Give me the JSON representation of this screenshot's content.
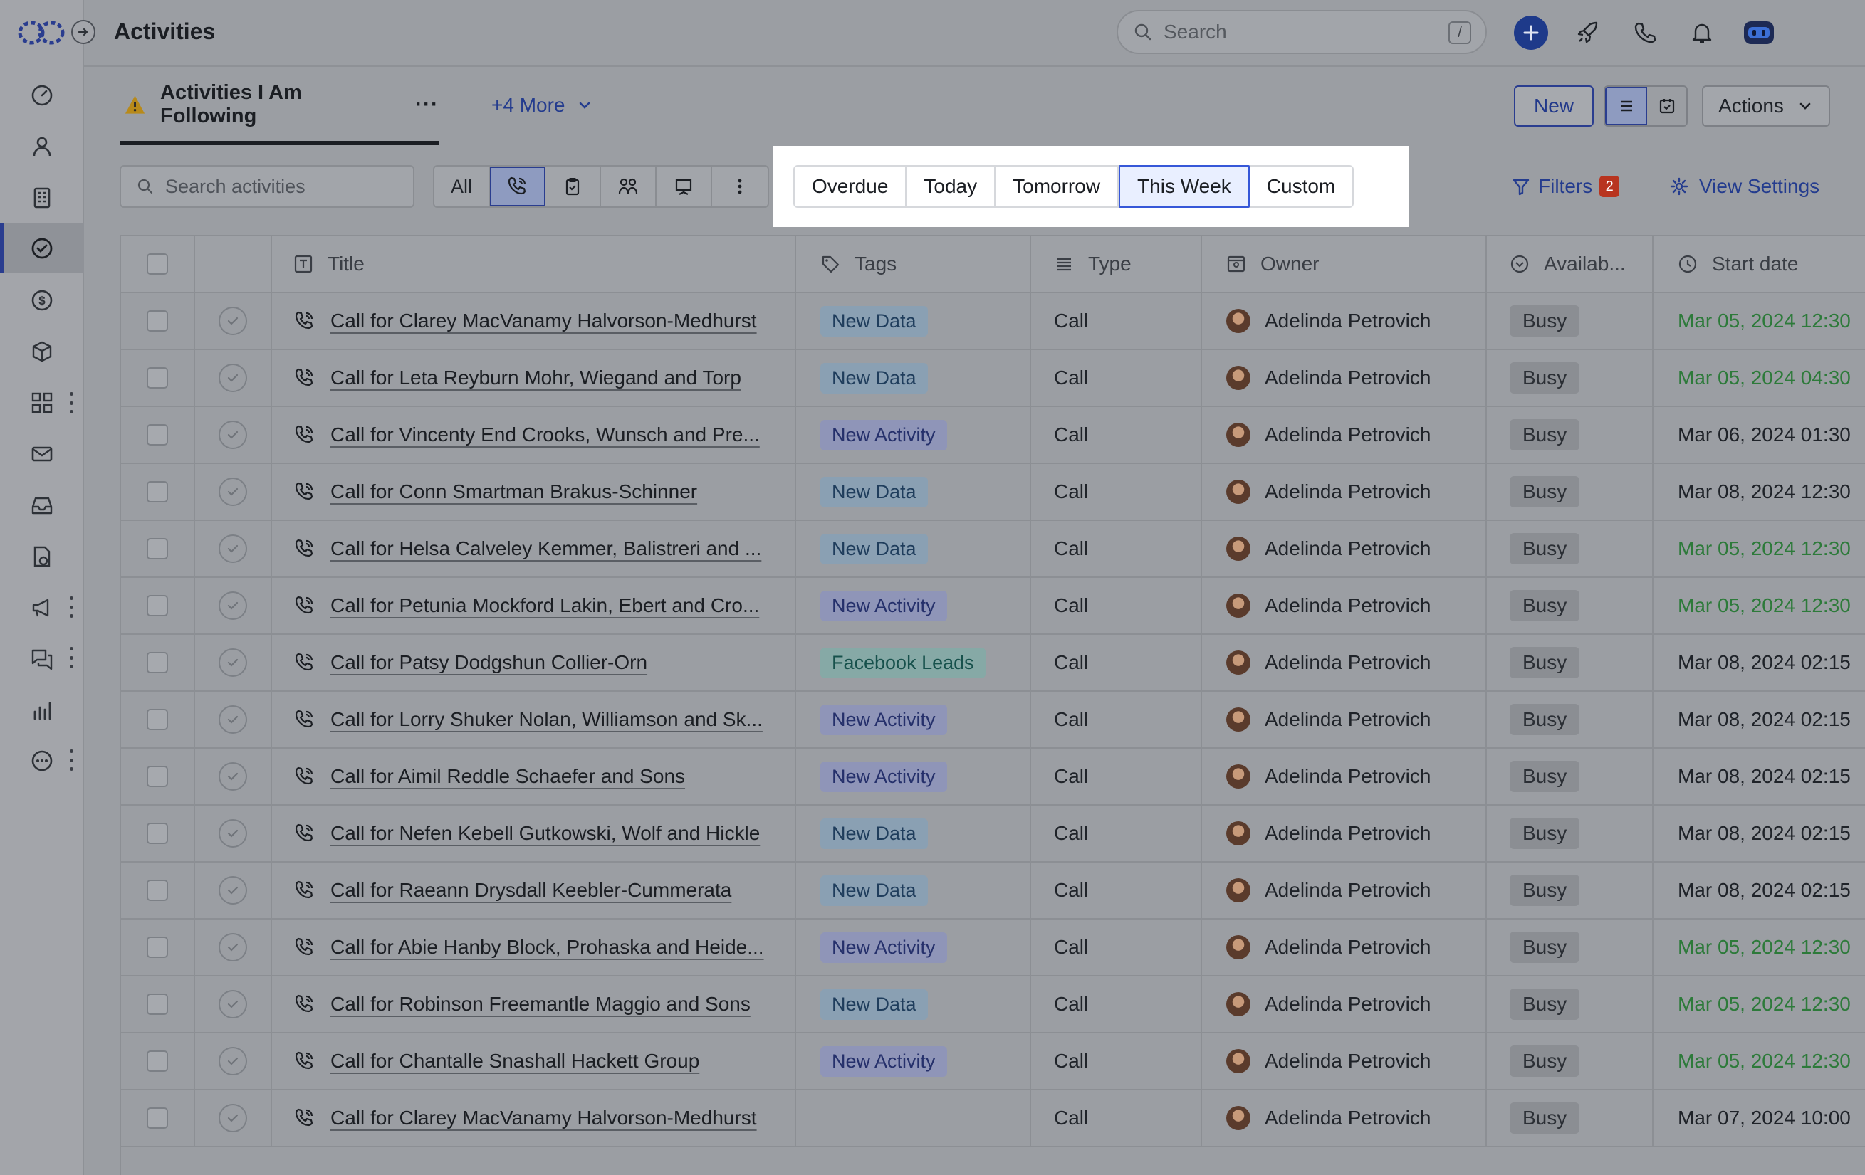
{
  "app": {
    "page_title": "Activities",
    "search_placeholder": "Search",
    "search_shortcut": "/"
  },
  "view": {
    "current": "Activities I Am Following",
    "more_views": "+4 More",
    "new_label": "New",
    "actions_label": "Actions"
  },
  "filters": {
    "search_placeholder": "Search activities",
    "type_all": "All",
    "date_options": [
      "Overdue",
      "Today",
      "Tomorrow",
      "This Week",
      "Custom"
    ],
    "date_selected": "This Week",
    "filters_label": "Filters",
    "filters_count": "2",
    "view_settings_label": "View Settings"
  },
  "columns": {
    "title": "Title",
    "tags": "Tags",
    "type": "Type",
    "owner": "Owner",
    "availability": "Availab...",
    "start_date": "Start date"
  },
  "rows": [
    {
      "title": "Call for Clarey MacVanamy Halvorson-Medhurst",
      "tag": "New Data",
      "tag_kind": "data",
      "type": "Call",
      "owner": "Adelinda Petrovich",
      "availability": "Busy",
      "start": "Mar 05, 2024 12:30",
      "due_soon": true
    },
    {
      "title": "Call for Leta Reyburn Mohr, Wiegand and Torp",
      "tag": "New Data",
      "tag_kind": "data",
      "type": "Call",
      "owner": "Adelinda Petrovich",
      "availability": "Busy",
      "start": "Mar 05, 2024 04:30",
      "due_soon": true
    },
    {
      "title": "Call for Vincenty End Crooks, Wunsch and Pre...",
      "tag": "New Activity",
      "tag_kind": "activity",
      "type": "Call",
      "owner": "Adelinda Petrovich",
      "availability": "Busy",
      "start": "Mar 06, 2024 01:30",
      "due_soon": false
    },
    {
      "title": "Call for Conn Smartman Brakus-Schinner",
      "tag": "New Data",
      "tag_kind": "data",
      "type": "Call",
      "owner": "Adelinda Petrovich",
      "availability": "Busy",
      "start": "Mar 08, 2024 12:30",
      "due_soon": false
    },
    {
      "title": "Call for Helsa Calveley Kemmer, Balistreri and ...",
      "tag": "New Data",
      "tag_kind": "data",
      "type": "Call",
      "owner": "Adelinda Petrovich",
      "availability": "Busy",
      "start": "Mar 05, 2024 12:30",
      "due_soon": true
    },
    {
      "title": "Call for Petunia Mockford Lakin, Ebert and Cro...",
      "tag": "New Activity",
      "tag_kind": "activity",
      "type": "Call",
      "owner": "Adelinda Petrovich",
      "availability": "Busy",
      "start": "Mar 05, 2024 12:30",
      "due_soon": true
    },
    {
      "title": "Call for Patsy Dodgshun Collier-Orn",
      "tag": "Facebook Leads",
      "tag_kind": "leads",
      "type": "Call",
      "owner": "Adelinda Petrovich",
      "availability": "Busy",
      "start": "Mar 08, 2024 02:15",
      "due_soon": false
    },
    {
      "title": "Call for Lorry Shuker Nolan, Williamson and Sk...",
      "tag": "New Activity",
      "tag_kind": "activity",
      "type": "Call",
      "owner": "Adelinda Petrovich",
      "availability": "Busy",
      "start": "Mar 08, 2024 02:15",
      "due_soon": false
    },
    {
      "title": "Call for Aimil Reddle Schaefer and Sons",
      "tag": "New Activity",
      "tag_kind": "activity",
      "type": "Call",
      "owner": "Adelinda Petrovich",
      "availability": "Busy",
      "start": "Mar 08, 2024 02:15",
      "due_soon": false
    },
    {
      "title": "Call for Nefen Kebell Gutkowski, Wolf and Hickle",
      "tag": "New Data",
      "tag_kind": "data",
      "type": "Call",
      "owner": "Adelinda Petrovich",
      "availability": "Busy",
      "start": "Mar 08, 2024 02:15",
      "due_soon": false
    },
    {
      "title": "Call for Raeann Drysdall Keebler-Cummerata",
      "tag": "New Data",
      "tag_kind": "data",
      "type": "Call",
      "owner": "Adelinda Petrovich",
      "availability": "Busy",
      "start": "Mar 08, 2024 02:15",
      "due_soon": false
    },
    {
      "title": "Call for Abie Hanby Block, Prohaska and Heide...",
      "tag": "New Activity",
      "tag_kind": "activity",
      "type": "Call",
      "owner": "Adelinda Petrovich",
      "availability": "Busy",
      "start": "Mar 05, 2024 12:30",
      "due_soon": true
    },
    {
      "title": "Call for Robinson Freemantle Maggio and Sons",
      "tag": "New Data",
      "tag_kind": "data",
      "type": "Call",
      "owner": "Adelinda Petrovich",
      "availability": "Busy",
      "start": "Mar 05, 2024 12:30",
      "due_soon": true
    },
    {
      "title": "Call for Chantalle Snashall Hackett Group",
      "tag": "New Activity",
      "tag_kind": "activity",
      "type": "Call",
      "owner": "Adelinda Petrovich",
      "availability": "Busy",
      "start": "Mar 05, 2024 12:30",
      "due_soon": true
    },
    {
      "title": "Call for Clarey MacVanamy Halvorson-Medhurst",
      "tag": "",
      "tag_kind": "",
      "type": "Call",
      "owner": "Adelinda Petrovich",
      "availability": "Busy",
      "start": "Mar 07, 2024 10:00",
      "due_soon": false
    }
  ],
  "nav_icons": [
    "dashboard-icon",
    "contacts-icon",
    "companies-icon",
    "activities-icon",
    "deals-icon",
    "products-icon",
    "apps-icon",
    "mail-icon",
    "inbox-icon",
    "documents-icon",
    "campaigns-icon",
    "chat-icon",
    "reports-icon",
    "more-icon"
  ],
  "colors": {
    "accent": "#243c8e",
    "due_soon": "#2d7a3a",
    "badge": "#b8341f"
  }
}
